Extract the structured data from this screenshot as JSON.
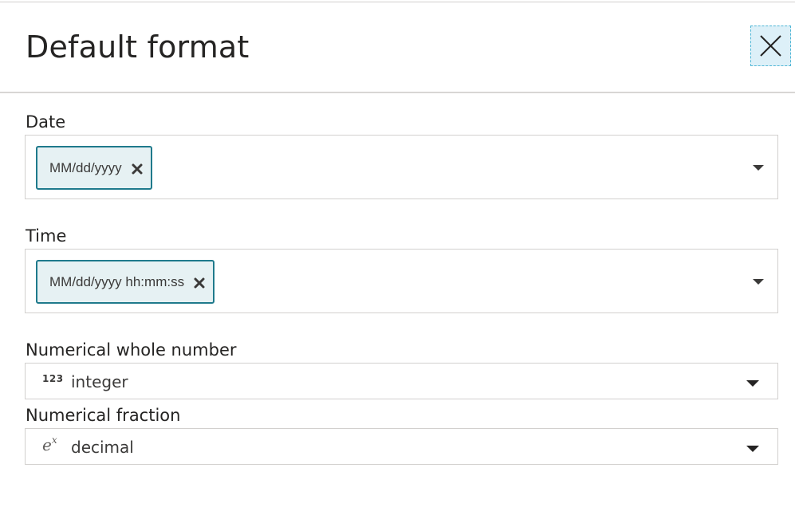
{
  "dialog": {
    "title": "Default format",
    "close_icon": "close-icon"
  },
  "date_field": {
    "label": "Date",
    "selected_tags": [
      "MM/dd/yyyy"
    ],
    "remove_icon": "remove-tag-icon",
    "dropdown_icon": "caret-down-icon"
  },
  "time_field": {
    "label": "Time",
    "selected_tags": [
      "MM/dd/yyyy hh:mm:ss"
    ],
    "remove_icon": "remove-tag-icon",
    "dropdown_icon": "caret-down-icon"
  },
  "whole_number_field": {
    "label": "Numerical whole number",
    "icon_text": "123",
    "value": "integer",
    "dropdown_icon": "caret-down-icon"
  },
  "fraction_field": {
    "label": "Numerical fraction",
    "icon_base": "e",
    "icon_exponent": "x",
    "value": "decimal",
    "dropdown_icon": "caret-down-icon"
  },
  "colors": {
    "chip_border": "#1f7a8c",
    "chip_background": "#e6f1f3",
    "close_button_background": "#ddf0f8",
    "border": "#d2d0ce",
    "text": "#252423"
  }
}
